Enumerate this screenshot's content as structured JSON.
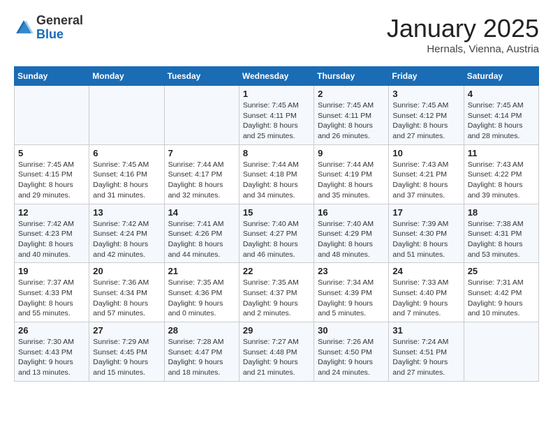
{
  "header": {
    "logo_general": "General",
    "logo_blue": "Blue",
    "title": "January 2025",
    "subtitle": "Hernals, Vienna, Austria"
  },
  "weekdays": [
    "Sunday",
    "Monday",
    "Tuesday",
    "Wednesday",
    "Thursday",
    "Friday",
    "Saturday"
  ],
  "weeks": [
    [
      {
        "day": "",
        "sunrise": "",
        "sunset": "",
        "daylight": ""
      },
      {
        "day": "",
        "sunrise": "",
        "sunset": "",
        "daylight": ""
      },
      {
        "day": "",
        "sunrise": "",
        "sunset": "",
        "daylight": ""
      },
      {
        "day": "1",
        "sunrise": "Sunrise: 7:45 AM",
        "sunset": "Sunset: 4:11 PM",
        "daylight": "Daylight: 8 hours and 25 minutes."
      },
      {
        "day": "2",
        "sunrise": "Sunrise: 7:45 AM",
        "sunset": "Sunset: 4:11 PM",
        "daylight": "Daylight: 8 hours and 26 minutes."
      },
      {
        "day": "3",
        "sunrise": "Sunrise: 7:45 AM",
        "sunset": "Sunset: 4:12 PM",
        "daylight": "Daylight: 8 hours and 27 minutes."
      },
      {
        "day": "4",
        "sunrise": "Sunrise: 7:45 AM",
        "sunset": "Sunset: 4:14 PM",
        "daylight": "Daylight: 8 hours and 28 minutes."
      }
    ],
    [
      {
        "day": "5",
        "sunrise": "Sunrise: 7:45 AM",
        "sunset": "Sunset: 4:15 PM",
        "daylight": "Daylight: 8 hours and 29 minutes."
      },
      {
        "day": "6",
        "sunrise": "Sunrise: 7:45 AM",
        "sunset": "Sunset: 4:16 PM",
        "daylight": "Daylight: 8 hours and 31 minutes."
      },
      {
        "day": "7",
        "sunrise": "Sunrise: 7:44 AM",
        "sunset": "Sunset: 4:17 PM",
        "daylight": "Daylight: 8 hours and 32 minutes."
      },
      {
        "day": "8",
        "sunrise": "Sunrise: 7:44 AM",
        "sunset": "Sunset: 4:18 PM",
        "daylight": "Daylight: 8 hours and 34 minutes."
      },
      {
        "day": "9",
        "sunrise": "Sunrise: 7:44 AM",
        "sunset": "Sunset: 4:19 PM",
        "daylight": "Daylight: 8 hours and 35 minutes."
      },
      {
        "day": "10",
        "sunrise": "Sunrise: 7:43 AM",
        "sunset": "Sunset: 4:21 PM",
        "daylight": "Daylight: 8 hours and 37 minutes."
      },
      {
        "day": "11",
        "sunrise": "Sunrise: 7:43 AM",
        "sunset": "Sunset: 4:22 PM",
        "daylight": "Daylight: 8 hours and 39 minutes."
      }
    ],
    [
      {
        "day": "12",
        "sunrise": "Sunrise: 7:42 AM",
        "sunset": "Sunset: 4:23 PM",
        "daylight": "Daylight: 8 hours and 40 minutes."
      },
      {
        "day": "13",
        "sunrise": "Sunrise: 7:42 AM",
        "sunset": "Sunset: 4:24 PM",
        "daylight": "Daylight: 8 hours and 42 minutes."
      },
      {
        "day": "14",
        "sunrise": "Sunrise: 7:41 AM",
        "sunset": "Sunset: 4:26 PM",
        "daylight": "Daylight: 8 hours and 44 minutes."
      },
      {
        "day": "15",
        "sunrise": "Sunrise: 7:40 AM",
        "sunset": "Sunset: 4:27 PM",
        "daylight": "Daylight: 8 hours and 46 minutes."
      },
      {
        "day": "16",
        "sunrise": "Sunrise: 7:40 AM",
        "sunset": "Sunset: 4:29 PM",
        "daylight": "Daylight: 8 hours and 48 minutes."
      },
      {
        "day": "17",
        "sunrise": "Sunrise: 7:39 AM",
        "sunset": "Sunset: 4:30 PM",
        "daylight": "Daylight: 8 hours and 51 minutes."
      },
      {
        "day": "18",
        "sunrise": "Sunrise: 7:38 AM",
        "sunset": "Sunset: 4:31 PM",
        "daylight": "Daylight: 8 hours and 53 minutes."
      }
    ],
    [
      {
        "day": "19",
        "sunrise": "Sunrise: 7:37 AM",
        "sunset": "Sunset: 4:33 PM",
        "daylight": "Daylight: 8 hours and 55 minutes."
      },
      {
        "day": "20",
        "sunrise": "Sunrise: 7:36 AM",
        "sunset": "Sunset: 4:34 PM",
        "daylight": "Daylight: 8 hours and 57 minutes."
      },
      {
        "day": "21",
        "sunrise": "Sunrise: 7:35 AM",
        "sunset": "Sunset: 4:36 PM",
        "daylight": "Daylight: 9 hours and 0 minutes."
      },
      {
        "day": "22",
        "sunrise": "Sunrise: 7:35 AM",
        "sunset": "Sunset: 4:37 PM",
        "daylight": "Daylight: 9 hours and 2 minutes."
      },
      {
        "day": "23",
        "sunrise": "Sunrise: 7:34 AM",
        "sunset": "Sunset: 4:39 PM",
        "daylight": "Daylight: 9 hours and 5 minutes."
      },
      {
        "day": "24",
        "sunrise": "Sunrise: 7:33 AM",
        "sunset": "Sunset: 4:40 PM",
        "daylight": "Daylight: 9 hours and 7 minutes."
      },
      {
        "day": "25",
        "sunrise": "Sunrise: 7:31 AM",
        "sunset": "Sunset: 4:42 PM",
        "daylight": "Daylight: 9 hours and 10 minutes."
      }
    ],
    [
      {
        "day": "26",
        "sunrise": "Sunrise: 7:30 AM",
        "sunset": "Sunset: 4:43 PM",
        "daylight": "Daylight: 9 hours and 13 minutes."
      },
      {
        "day": "27",
        "sunrise": "Sunrise: 7:29 AM",
        "sunset": "Sunset: 4:45 PM",
        "daylight": "Daylight: 9 hours and 15 minutes."
      },
      {
        "day": "28",
        "sunrise": "Sunrise: 7:28 AM",
        "sunset": "Sunset: 4:47 PM",
        "daylight": "Daylight: 9 hours and 18 minutes."
      },
      {
        "day": "29",
        "sunrise": "Sunrise: 7:27 AM",
        "sunset": "Sunset: 4:48 PM",
        "daylight": "Daylight: 9 hours and 21 minutes."
      },
      {
        "day": "30",
        "sunrise": "Sunrise: 7:26 AM",
        "sunset": "Sunset: 4:50 PM",
        "daylight": "Daylight: 9 hours and 24 minutes."
      },
      {
        "day": "31",
        "sunrise": "Sunrise: 7:24 AM",
        "sunset": "Sunset: 4:51 PM",
        "daylight": "Daylight: 9 hours and 27 minutes."
      },
      {
        "day": "",
        "sunrise": "",
        "sunset": "",
        "daylight": ""
      }
    ]
  ]
}
